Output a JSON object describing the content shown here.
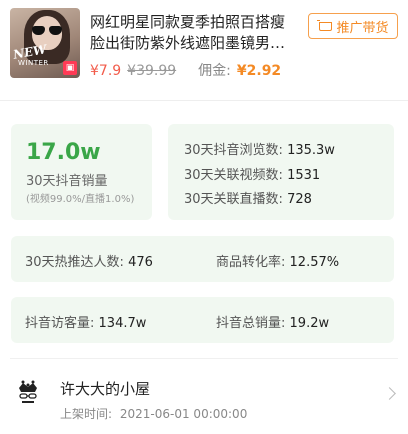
{
  "product": {
    "image_text": {
      "line1": "NEW",
      "line2": "WINTER"
    },
    "title": "网红明星同款夏季拍照百搭瘦脸出街防紫外线遮阳墨镜男…",
    "promo_button": "推广带货",
    "price": "¥7.9",
    "original_price": "¥39.99",
    "commission_label": "佣金:",
    "commission": "¥2.92"
  },
  "stats": {
    "sales_value": "17.0w",
    "sales_label": "30天抖音销量",
    "sales_breakdown": "(视频99.0%/直播1.0%)",
    "views_label": "30天抖音浏览数:",
    "views_value": "135.3w",
    "videos_label": "30天关联视频数:",
    "videos_value": "1531",
    "lives_label": "30天关联直播数:",
    "lives_value": "728",
    "promoters_label": "30天热推达人数:",
    "promoters_value": "476",
    "conversion_label": "商品转化率:",
    "conversion_value": "12.57%",
    "visits_label": "抖音访客量:",
    "visits_value": "134.7w",
    "total_sales_label": "抖音总销量:",
    "total_sales_value": "19.2w"
  },
  "shop": {
    "name": "许大大的小屋",
    "listing_label": "上架时间:",
    "listing_time": "2021-06-01 00:00:00"
  },
  "colors": {
    "accent_orange": "#f48a25",
    "price_red": "#f25c4b",
    "card_bg": "#f1f8f1",
    "big_green": "#3aa648"
  }
}
